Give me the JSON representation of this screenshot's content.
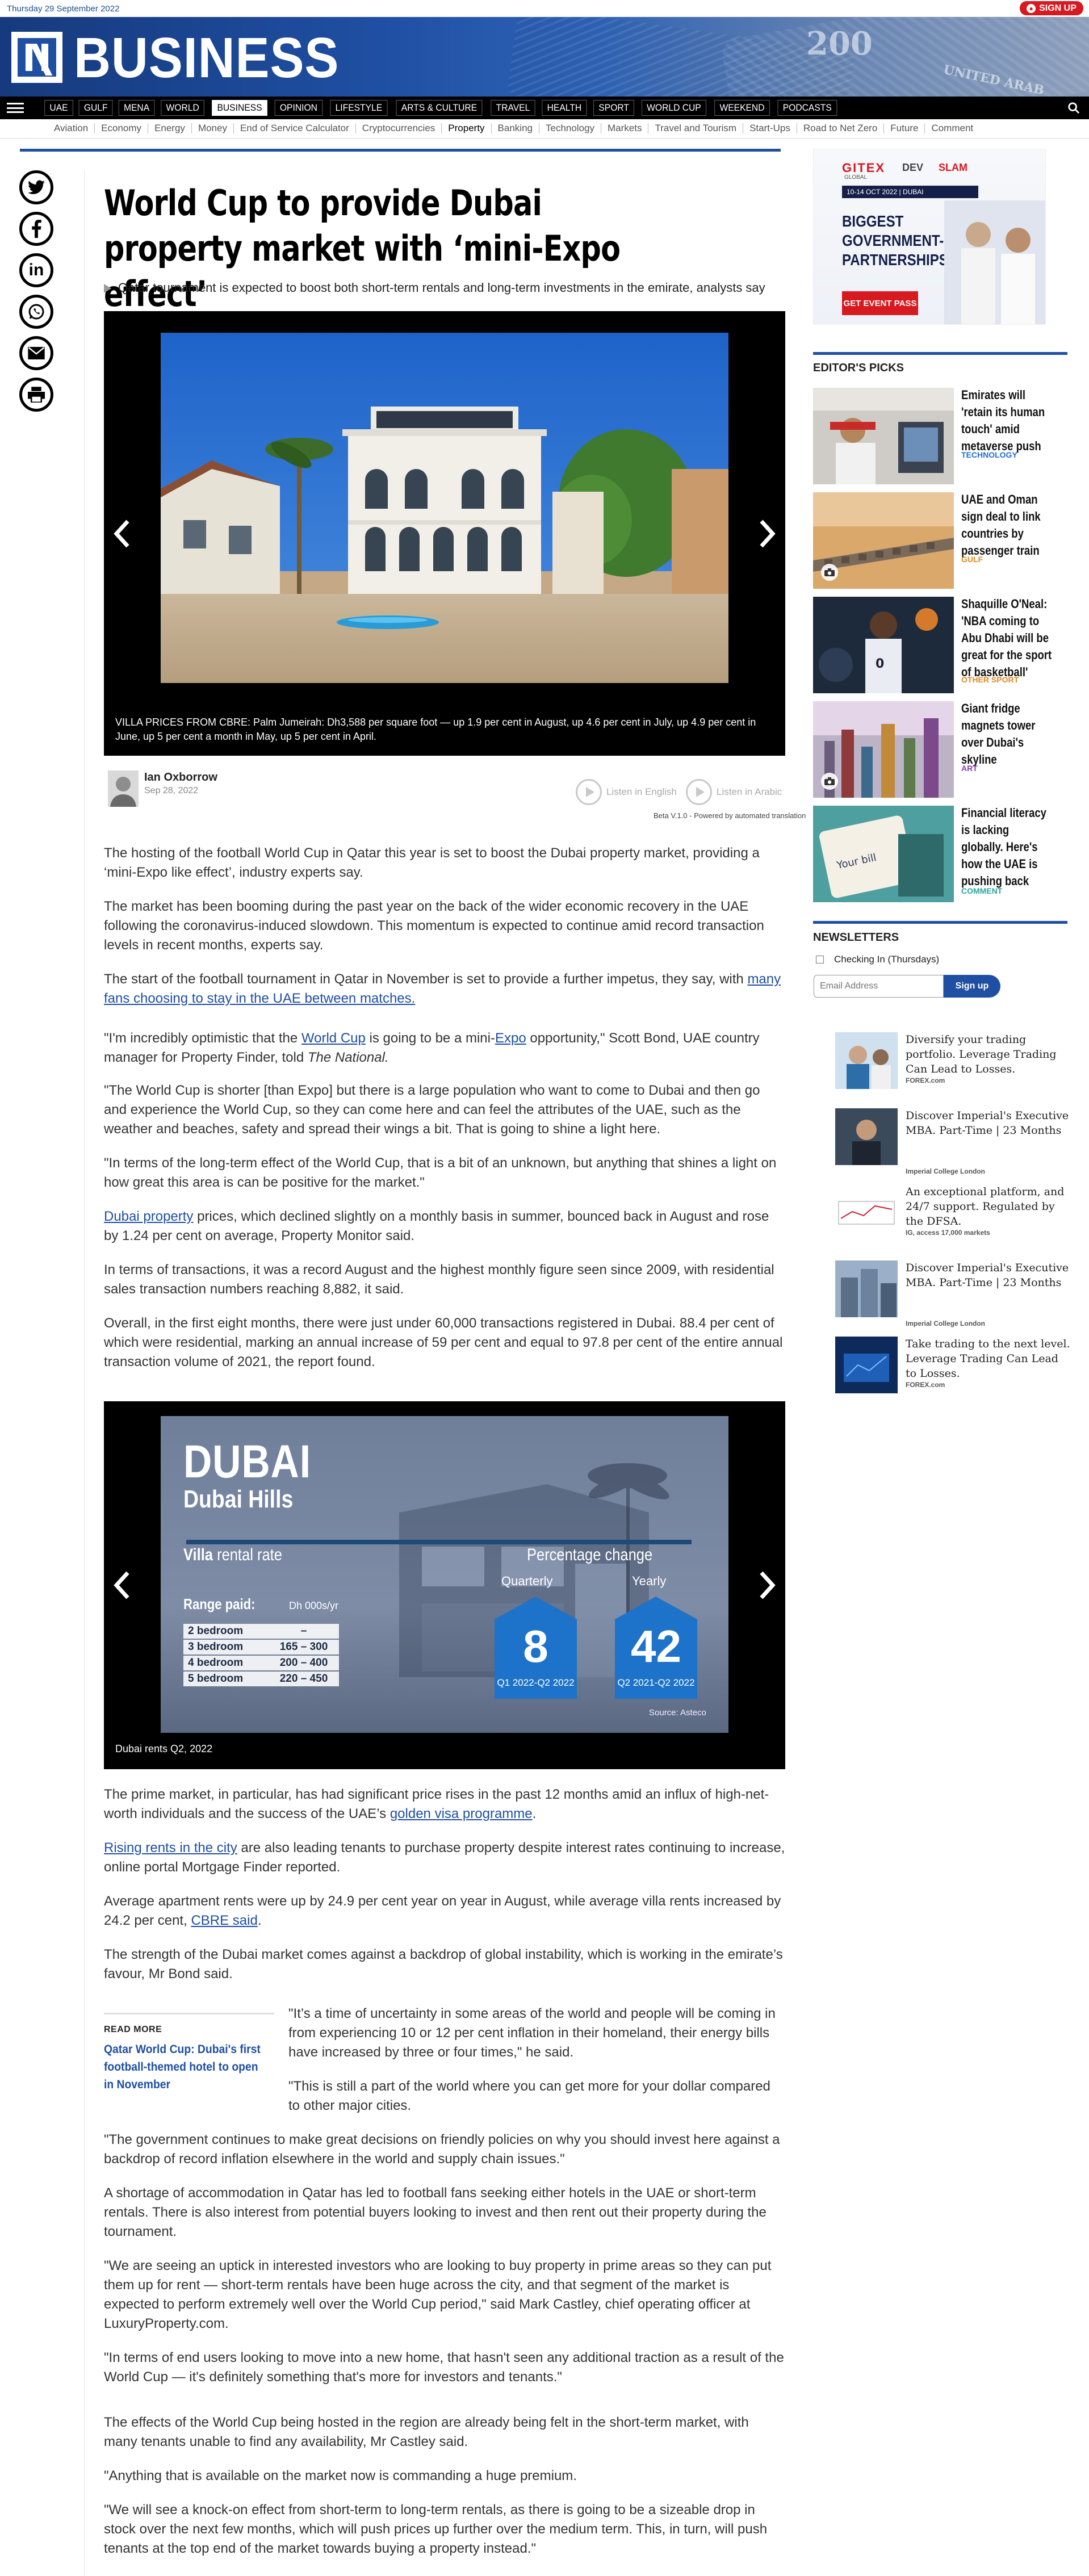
{
  "topbar": {
    "date": "Thursday 29 September 2022",
    "signup": "SIGN UP"
  },
  "masthead": {
    "title": "BUSINESS",
    "banknote_text_1": "200",
    "banknote_text_2": "UNITED ARAB"
  },
  "nav": {
    "items": [
      "UAE",
      "GULF",
      "MENA",
      "WORLD",
      "BUSINESS",
      "OPINION",
      "LIFESTYLE",
      "ARTS & CULTURE",
      "TRAVEL",
      "HEALTH",
      "SPORT",
      "WORLD CUP",
      "WEEKEND",
      "PODCASTS"
    ],
    "active": "BUSINESS"
  },
  "subnav": {
    "items": [
      "Aviation",
      "Economy",
      "Energy",
      "Money",
      "End of Service Calculator",
      "Cryptocurrencies",
      "Property",
      "Banking",
      "Technology",
      "Markets",
      "Travel and Tourism",
      "Start-Ups",
      "Road to Net Zero",
      "Future",
      "Comment"
    ],
    "active": "Property"
  },
  "share_icons": [
    "twitter-icon",
    "facebook-icon",
    "linkedin-icon",
    "whatsapp-icon",
    "email-icon",
    "print-icon"
  ],
  "article": {
    "headline": "World Cup to provide Dubai property market with ‘mini-Expo effect’",
    "standfirst": "Qatar tournament is expected to boost both short-term rentals and long-term investments in the emirate, analysts say",
    "gallery1": {
      "caption": "VILLA PRICES FROM CBRE: Palm Jumeirah: Dh3,588 per square foot — up 1.9 per cent in August, up 4.6 per cent in July, up 4.9 per cent in June, up 5 per cent a month in May, up 5 per cent in April."
    },
    "author": {
      "name": "Ian Oxborrow",
      "date": "Sep 28, 2022"
    },
    "listen": {
      "english": "Listen in English",
      "arabic": "Listen in Arabic",
      "beta": "Beta V.1.0 - Powered by automated translation"
    },
    "paragraphs": {
      "p1": "The hosting of the football World Cup in Qatar this year is set to boost the Dubai property market, providing a ‘mini-Expo like effect’, industry experts say.",
      "p2": "The market has been booming during the past year on the back of the wider economic recovery in the UAE following the coronavirus-induced slowdown. This momentum is expected to continue amid record transaction levels in recent months, experts say.",
      "p3_a": "The start of the football tournament in Qatar in November is set to provide a further impetus, they say, with ",
      "p3_link": "many fans choosing to stay in the UAE between matches.",
      "p4_a": "\"I'm incredibly optimistic that the ",
      "p4_link1": "World Cup",
      "p4_b": " is going to be a mini-",
      "p4_link2": "Expo",
      "p4_c": " opportunity,\" Scott Bond, UAE country manager for Property Finder, told ",
      "p4_italic": "The National.",
      "p5": "\"The World Cup is shorter [than Expo] but there is a large population who want to come to Dubai and then go and experience the World Cup, so they can come here and can feel the attributes of the UAE, such as the weather and beaches, safety and spread their wings a bit. That is going to shine a light here.",
      "p6": "\"In terms of the long-term effect of the World Cup, that is a bit of an unknown, but anything that shines a light on how great this area is can be positive for the market.\"",
      "p7_link": "Dubai property",
      "p7_a": " prices, which declined slightly on a monthly basis in summer, bounced back in August and rose by 1.24 per cent on average, Property Monitor said.",
      "p8": "In terms of transactions, it was a record August and the highest monthly figure seen since 2009, with residential sales transaction numbers reaching 8,882, it said.",
      "p9": "Overall, in the first eight months, there were just under 60,000 transactions registered in Dubai. 88.4 per cent of which were residential, marking an annual increase of 59 per cent and equal to 97.8 per cent of the entire annual transaction volume of 2021, the report found.",
      "p10_a": "The prime market, in particular, has had significant price rises in the past 12 months amid an influx of high-net-worth individuals and the success of the UAE’s ",
      "p10_link": "golden visa programme",
      "p10_b": ".",
      "p11_link": "Rising rents in the city",
      "p11_a": " are also leading tenants to purchase property despite interest rates continuing to increase, online portal Mortgage Finder reported.",
      "p12_a": "Average apartment rents were up by 24.9 per cent year on year in August, while average villa rents increased by 24.2 per cent, ",
      "p12_link": "CBRE said",
      "p12_b": ".",
      "p13": "The strength of the Dubai market comes against a backdrop of global instability, which is working in the emirate’s favour, Mr Bond said.",
      "p14": "\"It’s a time of uncertainty in some areas of the world and people will be coming in from experiencing 10 or 12 per cent inflation in their homeland, their energy bills have increased by three or four times,\" he said.",
      "p15": "\"This is still a part of the world where you can get more for your dollar compared to other major cities.",
      "p16": "\"The government continues to make great decisions on friendly policies on why you should invest here against a backdrop of record inflation elsewhere in the world and supply chain issues.\"",
      "p17": "A shortage of accommodation in Qatar has led to football fans seeking either hotels in the UAE or short-term rentals. There is also interest from potential buyers looking to invest and then rent out their property during the tournament.",
      "p18": "\"We are seeing an uptick in interested investors who are looking to buy property in prime areas so they can put them up for rent — short-term rentals have been huge across the city, and that segment of the market is expected to perform extremely well over the World Cup period,\" said Mark Castley, chief operating officer at LuxuryProperty.com.",
      "p19": "\"In terms of end users looking to move into a new home, that hasn't seen any additional traction as a result of the World Cup — it's definitely something that's more for investors and tenants.\"",
      "p20": "The effects of the World Cup being hosted in the region are already being felt in the short-term market, with many tenants unable to find any availability, Mr Castley said.",
      "p21": "\"Anything that is available on the market now is commanding a huge premium.",
      "p22": "\"We will see a knock-on effect from short-term to long-term rentals, as there is going to be a sizeable drop in stock over the next few months, which will push prices up further over the medium term. This, in turn, will push tenants at the top end of the market towards buying a property instead.\""
    },
    "readmore": {
      "label": "READ MORE",
      "link": "Qatar World Cup: Dubai's first football-themed hotel to open in November"
    },
    "gallery2": {
      "caption": "Dubai rents Q2, 2022",
      "infographic": {
        "city": "DUBAI",
        "area": "Dubai Hills",
        "villa": "Villa",
        "rental_rate": " rental rate",
        "pct_heading": "Percentage change",
        "range_label": "Range paid:",
        "unit": "Dh 000s/yr",
        "rows": [
          {
            "type": "2 bedroom",
            "range": "–"
          },
          {
            "type": "3 bedroom",
            "range": "165 – 300"
          },
          {
            "type": "4 bedroom",
            "range": "200 – 400"
          },
          {
            "type": "5 bedroom",
            "range": "220 – 450"
          }
        ],
        "quarterly_label": "Quarterly",
        "yearly_label": "Yearly",
        "quarterly_value": "8",
        "yearly_value": "42",
        "quarterly_period": "Q1 2022-Q2 2022",
        "yearly_period": "Q2 2021-Q2 2022",
        "source": "Source: Asteco"
      }
    }
  },
  "sidebar": {
    "ad": {
      "brand": "GITEX",
      "brand_sub": "GLOBAL",
      "dev": "DEV",
      "slam": "SLAM",
      "dates": "10-14 OCT 2022 | DUBAI",
      "headline": "BIGGEST GOVERNMENT- PARTNERSHIPS",
      "cta": "GET EVENT PASS"
    },
    "editors_picks_heading": "EDITOR'S PICKS",
    "picks": [
      {
        "title": "Emirates will 'retain its human touch' amid metaverse push",
        "category": "TECHNOLOGY",
        "cat_color": "#1f6fd1"
      },
      {
        "title": "UAE and Oman sign deal to link countries by passenger train",
        "category": "GULF",
        "cat_color": "#e08a1e"
      },
      {
        "title": "Shaquille O'Neal: 'NBA coming to Abu Dhabi will be great for the sport of basketball'",
        "category": "OTHER SPORT",
        "cat_color": "#e08a1e"
      },
      {
        "title": "Giant fridge magnets tower over Dubai's skyline",
        "category": "ART",
        "cat_color": "#8c3bb5"
      },
      {
        "title": "Financial literacy is lacking globally. Here's how the UAE is pushing back",
        "category": "COMMENT",
        "cat_color": "#2aa6a1"
      }
    ],
    "newsletters": {
      "heading": "NEWSLETTERS",
      "checkbox_label": "Checking In (Thursdays)",
      "email_placeholder": "Email Address",
      "button": "Sign up"
    },
    "sponsored": [
      {
        "title": "Diversify your trading portfolio. Leverage Trading Can Lead to Losses.",
        "source": "FOREX.com"
      },
      {
        "title": "Discover Imperial's Executive MBA. Part-Time | 23 Months",
        "source": "Imperial College London"
      },
      {
        "title": "An exceptional platform, and 24/7 support. Regulated by the DFSA.",
        "source": "IG, access 17,000 markets"
      },
      {
        "title": "Discover Imperial's Executive MBA. Part-Time | 23 Months",
        "source": "Imperial College London"
      },
      {
        "title": "Take trading to the next level. Leverage Trading Can Lead to Losses.",
        "source": "FOREX.com"
      }
    ]
  }
}
